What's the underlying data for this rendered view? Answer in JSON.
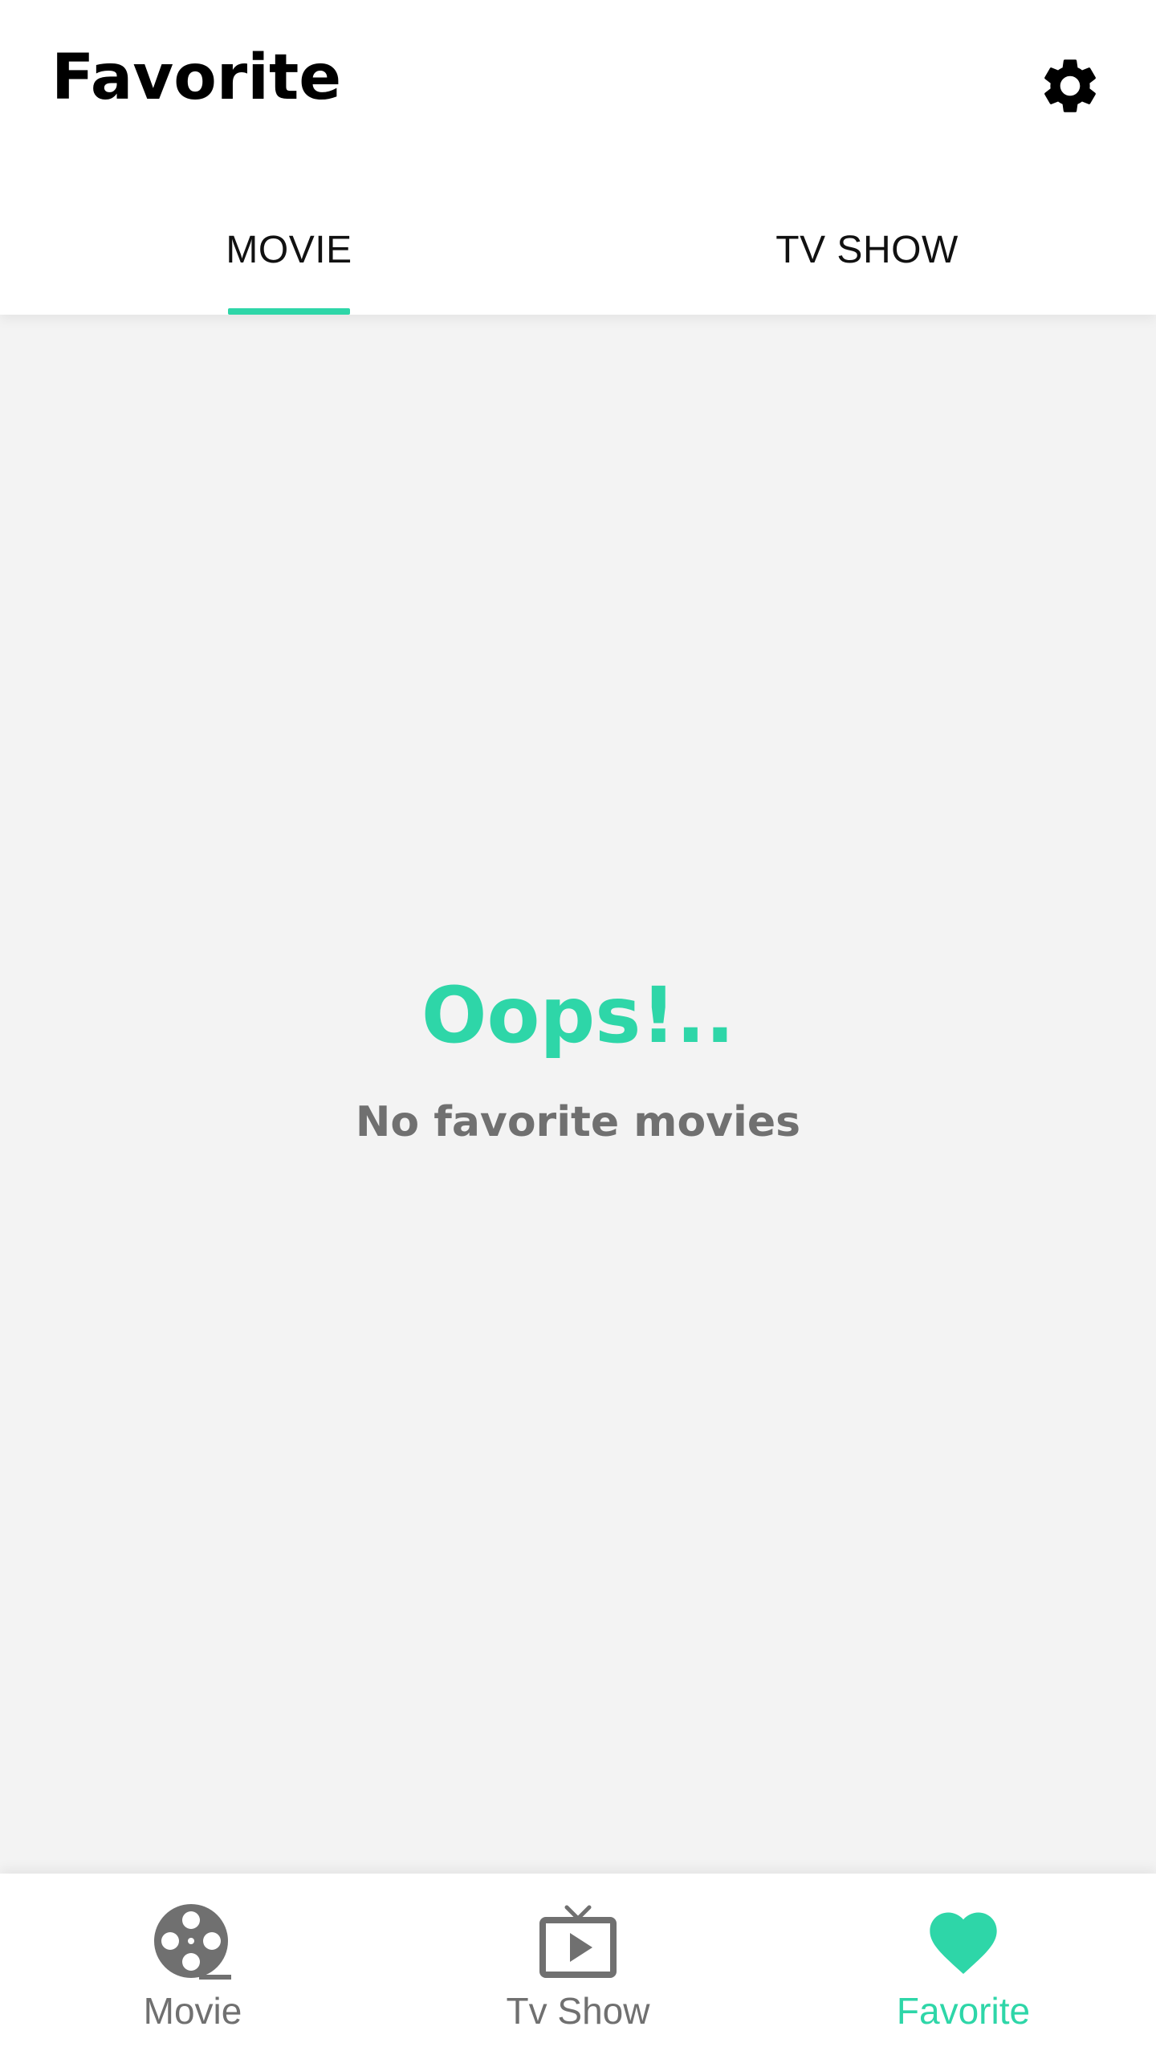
{
  "header": {
    "title": "Favorite"
  },
  "tabs": [
    {
      "label": "MOVIE",
      "selected": true
    },
    {
      "label": "TV SHOW",
      "selected": false
    }
  ],
  "empty_state": {
    "heading": "Oops!..",
    "message": "No favorite movies"
  },
  "bottom_nav": [
    {
      "label": "Movie",
      "icon": "film-reel-icon",
      "selected": false
    },
    {
      "label": "Tv Show",
      "icon": "tv-play-icon",
      "selected": false
    },
    {
      "label": "Favorite",
      "icon": "heart-icon",
      "selected": true
    }
  ],
  "colors": {
    "accent": "#2ed6a8",
    "inactive_nav": "#707070",
    "background": "#f3f3f3",
    "surface": "#ffffff",
    "title_text": "#000000"
  }
}
